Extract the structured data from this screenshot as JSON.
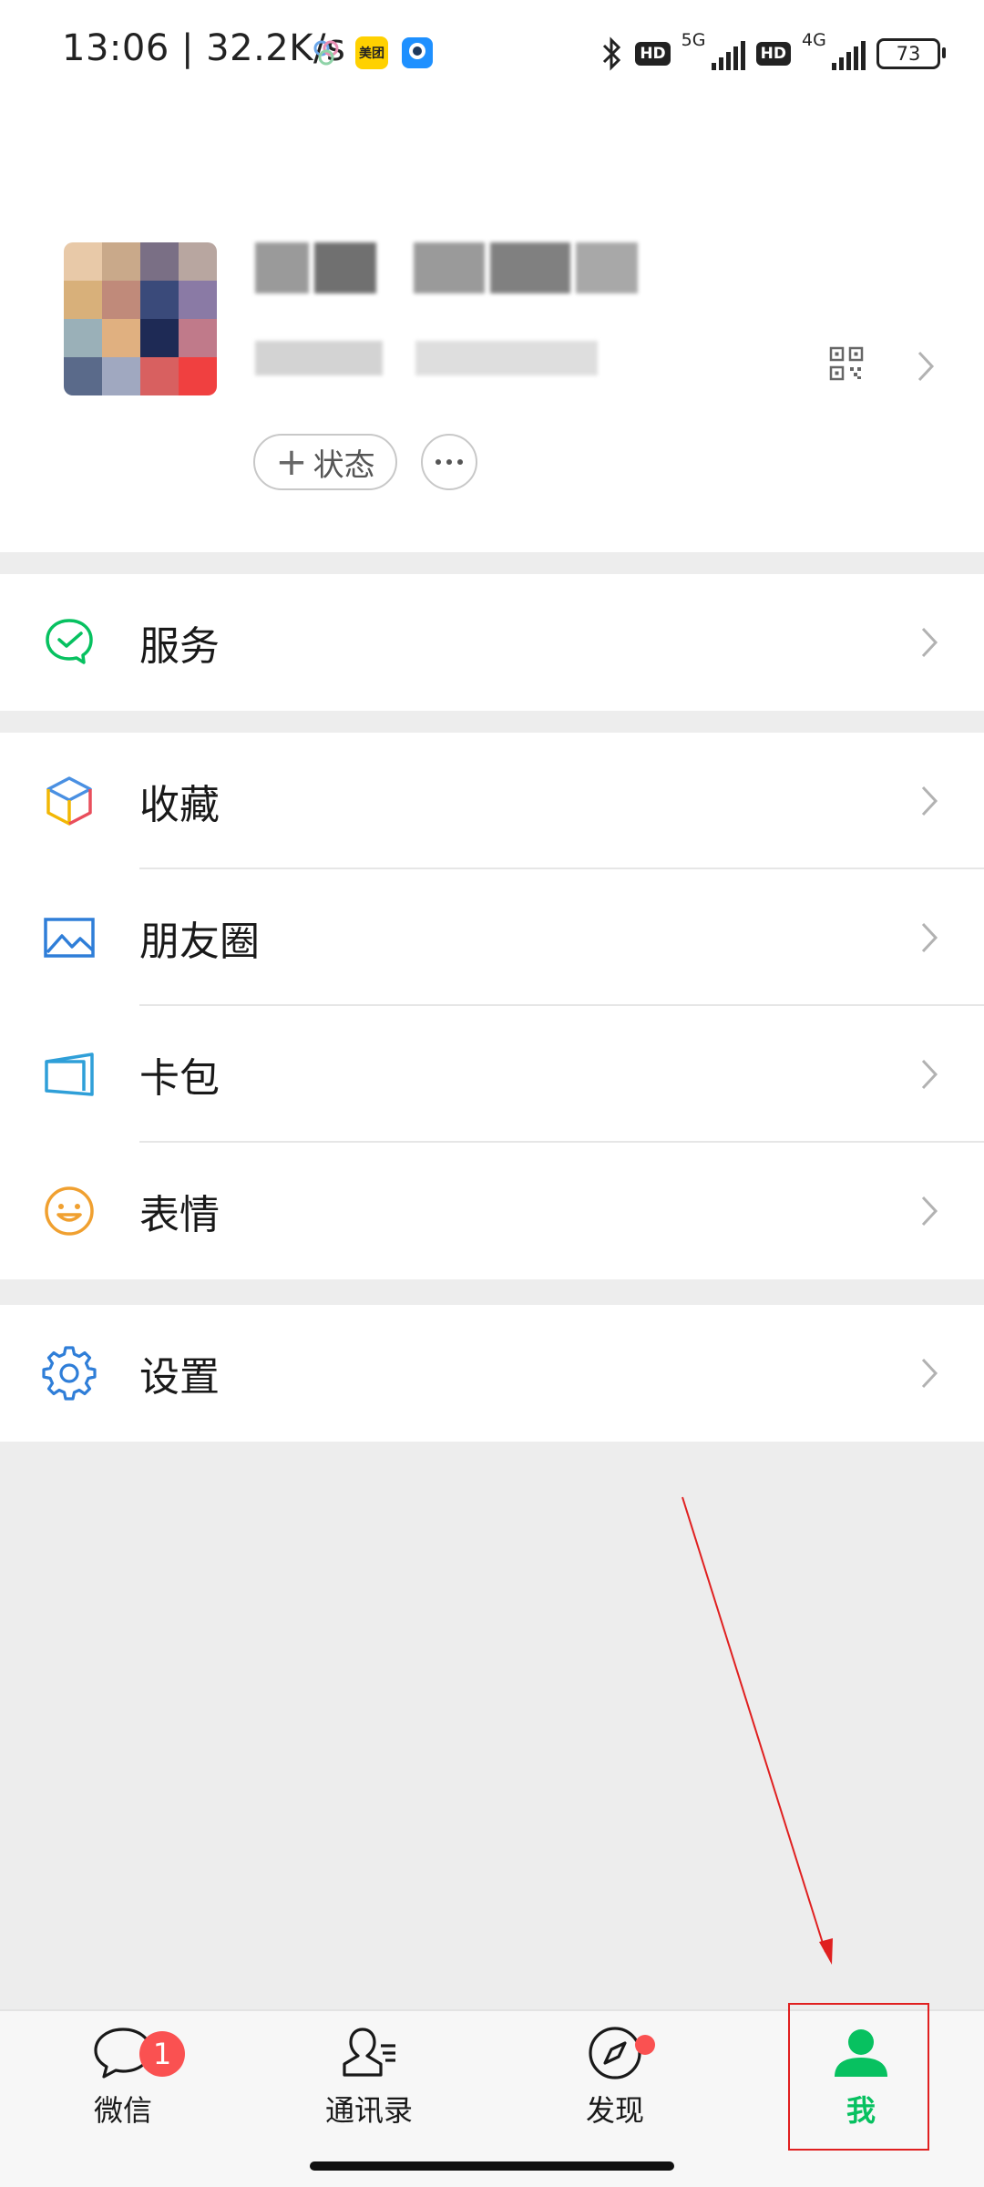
{
  "status_bar": {
    "time_speed": "13:06 | 32.2K/s",
    "app_icons": [
      "bubbles-app-icon",
      "meituan-app-icon",
      "robot-app-icon"
    ],
    "meituan_label": "美团",
    "net1": "5G",
    "net2": "4G",
    "hd": "HD",
    "battery": "73"
  },
  "profile": {
    "status_button": "状态",
    "plus": "+"
  },
  "menu": {
    "services": "服务",
    "favorites": "收藏",
    "moments": "朋友圈",
    "cards": "卡包",
    "stickers": "表情",
    "settings": "设置"
  },
  "tabs": [
    {
      "label": "微信",
      "badge": "1"
    },
    {
      "label": "通讯录"
    },
    {
      "label": "发现"
    },
    {
      "label": "我"
    }
  ],
  "colors": {
    "accent": "#07c160",
    "badge": "#fa5151",
    "annotation": "#e02020"
  }
}
